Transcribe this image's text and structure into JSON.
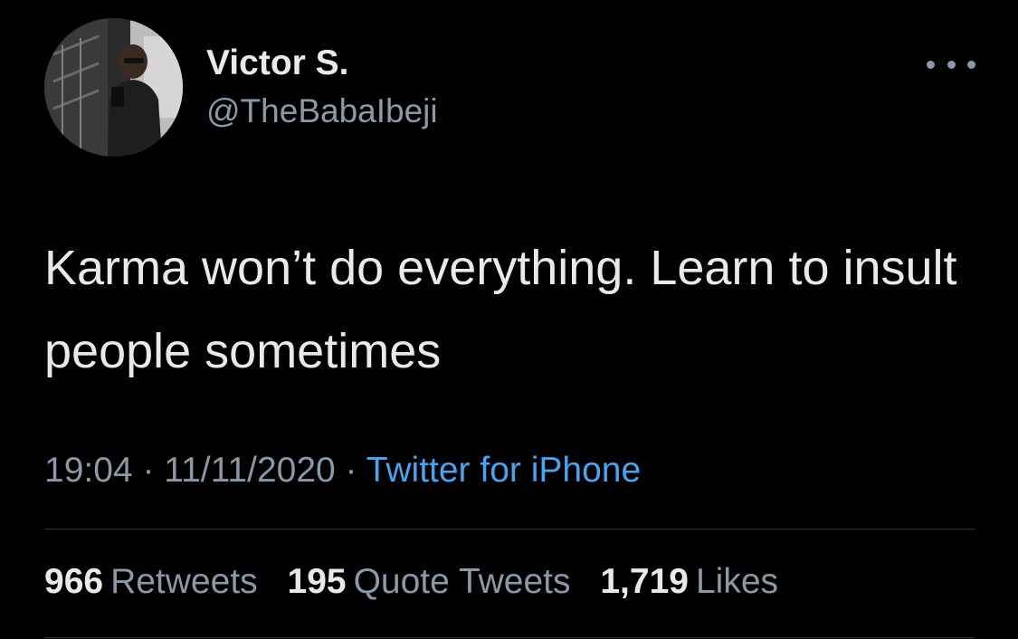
{
  "author": {
    "display_name": "Victor S.",
    "handle": "@TheBabaIbeji"
  },
  "tweet": {
    "text": "Karma won’t do everything. Learn to insult people sometimes"
  },
  "meta": {
    "time": "19:04",
    "separator": "·",
    "date": "11/11/2020",
    "source": "Twitter for iPhone"
  },
  "stats": {
    "retweets_count": "966",
    "retweets_label": "Retweets",
    "quotes_count": "195",
    "quotes_label": "Quote Tweets",
    "likes_count": "1,719",
    "likes_label": "Likes"
  },
  "icons": {
    "more": "more-options-icon"
  },
  "colors": {
    "background": "#000000",
    "primary_text": "#e7e9ea",
    "secondary_text": "#8b98a5",
    "link": "#4aa3ef",
    "divider": "#2f3336"
  }
}
